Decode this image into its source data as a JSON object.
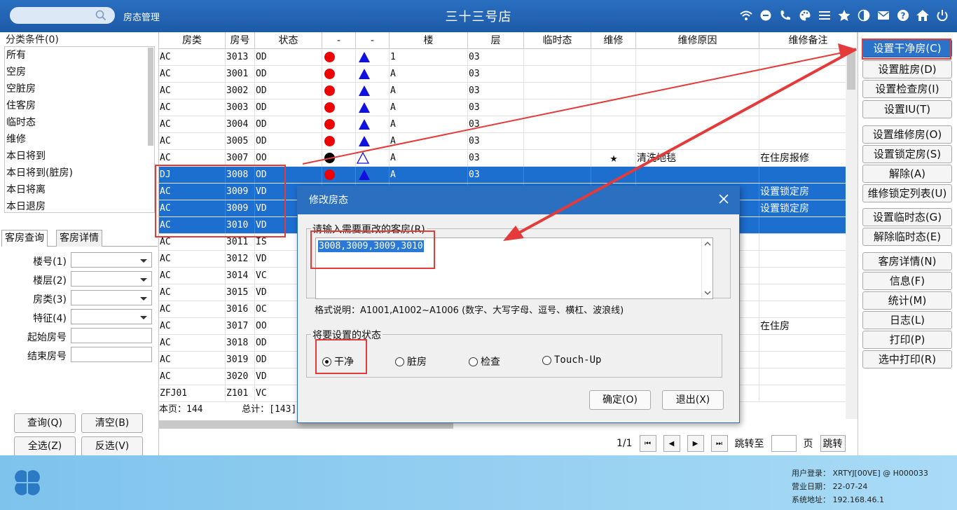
{
  "app": {
    "module": "房态管理",
    "title": "三十三号店"
  },
  "left": {
    "category_header": "分类条件(0)",
    "categories": [
      "所有",
      "空房",
      "空脏房",
      "住客房",
      "临时态",
      "维修",
      "本日将到",
      "本日将到(脏房)",
      "本日将离",
      "本日退房"
    ],
    "tabs": [
      "客房查询",
      "客房详情"
    ],
    "filters": [
      {
        "label": "楼号(1)",
        "type": "select"
      },
      {
        "label": "楼层(2)",
        "type": "select"
      },
      {
        "label": "房类(3)",
        "type": "select"
      },
      {
        "label": "特征(4)",
        "type": "select"
      },
      {
        "label": "起始房号",
        "type": "input"
      },
      {
        "label": "结束房号",
        "type": "input"
      }
    ],
    "buttons": [
      "查询(Q)",
      "清空(B)",
      "全选(Z)",
      "反选(V)"
    ]
  },
  "grid": {
    "columns": [
      "房类",
      "房号",
      "状态",
      "-",
      "-",
      "楼",
      "层",
      "临时态",
      "维修",
      "维修原因",
      "维修备注"
    ],
    "rows": [
      {
        "type": "AC",
        "no": "3013",
        "st": "OD",
        "dot": "red",
        "tri": "filled",
        "bld": "1",
        "fl": "03",
        "tmp": "",
        "rep": "",
        "reason": "",
        "note": "",
        "sel": false
      },
      {
        "type": "AC",
        "no": "3001",
        "st": "OD",
        "dot": "red",
        "tri": "filled",
        "bld": "A",
        "fl": "03",
        "tmp": "",
        "rep": "",
        "reason": "",
        "note": "",
        "sel": false
      },
      {
        "type": "AC",
        "no": "3002",
        "st": "OD",
        "dot": "red",
        "tri": "filled",
        "bld": "A",
        "fl": "03",
        "tmp": "",
        "rep": "",
        "reason": "",
        "note": "",
        "sel": false
      },
      {
        "type": "AC",
        "no": "3003",
        "st": "OD",
        "dot": "red",
        "tri": "filled",
        "bld": "A",
        "fl": "03",
        "tmp": "",
        "rep": "",
        "reason": "",
        "note": "",
        "sel": false
      },
      {
        "type": "AC",
        "no": "3004",
        "st": "OD",
        "dot": "red",
        "tri": "filled",
        "bld": "A",
        "fl": "03",
        "tmp": "",
        "rep": "",
        "reason": "",
        "note": "",
        "sel": false
      },
      {
        "type": "AC",
        "no": "3005",
        "st": "OD",
        "dot": "red",
        "tri": "filled",
        "bld": "A",
        "fl": "03",
        "tmp": "",
        "rep": "",
        "reason": "",
        "note": "",
        "sel": false
      },
      {
        "type": "AC",
        "no": "3007",
        "st": "OO",
        "dot": "black",
        "tri": "outline",
        "bld": "A",
        "fl": "03",
        "tmp": "",
        "rep": "★",
        "reason": "清洗地毯",
        "note": "在住房报修",
        "sel": false
      },
      {
        "type": "DJ",
        "no": "3008",
        "st": "OD",
        "dot": "red",
        "tri": "filled",
        "bld": "A",
        "fl": "03",
        "tmp": "",
        "rep": "",
        "reason": "",
        "note": "",
        "sel": true
      },
      {
        "type": "AC",
        "no": "3009",
        "st": "VD",
        "dot": "",
        "tri": "",
        "bld": "",
        "fl": "",
        "tmp": "",
        "rep": "",
        "reason": "",
        "note": "设置锁定房",
        "sel": true
      },
      {
        "type": "AC",
        "no": "3009",
        "st": "VD",
        "dot": "",
        "tri": "",
        "bld": "",
        "fl": "",
        "tmp": "",
        "rep": "",
        "reason": "",
        "note": "设置锁定房",
        "sel": true
      },
      {
        "type": "AC",
        "no": "3010",
        "st": "VD",
        "dot": "",
        "tri": "",
        "bld": "",
        "fl": "",
        "tmp": "",
        "rep": "",
        "reason": "",
        "note": "",
        "sel": true
      },
      {
        "type": "AC",
        "no": "3011",
        "st": "IS",
        "dot": "",
        "tri": "",
        "bld": "",
        "fl": "",
        "tmp": "",
        "rep": "",
        "reason": "",
        "note": "",
        "sel": false
      },
      {
        "type": "AC",
        "no": "3012",
        "st": "VD",
        "dot": "",
        "tri": "",
        "bld": "",
        "fl": "",
        "tmp": "",
        "rep": "",
        "reason": "",
        "note": "",
        "sel": false
      },
      {
        "type": "AC",
        "no": "3014",
        "st": "VC",
        "dot": "",
        "tri": "",
        "bld": "",
        "fl": "",
        "tmp": "",
        "rep": "",
        "reason": "",
        "note": "",
        "sel": false
      },
      {
        "type": "AC",
        "no": "3015",
        "st": "VD",
        "dot": "",
        "tri": "",
        "bld": "",
        "fl": "",
        "tmp": "",
        "rep": "",
        "reason": "",
        "note": "",
        "sel": false
      },
      {
        "type": "AC",
        "no": "3016",
        "st": "OC",
        "dot": "",
        "tri": "",
        "bld": "",
        "fl": "",
        "tmp": "",
        "rep": "",
        "reason": "",
        "note": "",
        "sel": false
      },
      {
        "type": "AC",
        "no": "3017",
        "st": "OO",
        "dot": "",
        "tri": "",
        "bld": "",
        "fl": "",
        "tmp": "",
        "rep": "",
        "reason": "",
        "note": "在住房",
        "sel": false
      },
      {
        "type": "AC",
        "no": "3018",
        "st": "OD",
        "dot": "",
        "tri": "",
        "bld": "",
        "fl": "",
        "tmp": "",
        "rep": "",
        "reason": "",
        "note": "",
        "sel": false
      },
      {
        "type": "AC",
        "no": "3019",
        "st": "OD",
        "dot": "",
        "tri": "",
        "bld": "",
        "fl": "",
        "tmp": "",
        "rep": "",
        "reason": "",
        "note": "",
        "sel": false
      },
      {
        "type": "AC",
        "no": "3020",
        "st": "VD",
        "dot": "",
        "tri": "",
        "bld": "",
        "fl": "",
        "tmp": "",
        "rep": "",
        "reason": "",
        "note": "",
        "sel": false
      },
      {
        "type": "ZFJ01",
        "no": "Z101",
        "st": "VC",
        "dot": "",
        "tri": "",
        "bld": "",
        "fl": "",
        "tmp": "",
        "rep": "",
        "reason": "",
        "note": "",
        "sel": false
      }
    ],
    "summary_page": "本页：144",
    "summary_total": "总计：[143]"
  },
  "pager": {
    "page": "1/1",
    "jump_label": "跳转至",
    "page_unit": "页",
    "jump_button": "跳转"
  },
  "right_buttons": [
    "设置干净房(C)",
    "设置脏房(D)",
    "设置检查房(I)",
    "设置IU(T)",
    "设置维修房(O)",
    "设置锁定房(S)",
    "解除(A)",
    "维修锁定列表(U)",
    "设置临时态(G)",
    "解除临时态(E)",
    "客房详情(N)",
    "信息(F)",
    "统计(M)",
    "日志(L)",
    "打印(P)",
    "选中打印(R)"
  ],
  "footer": {
    "user": "用户登录：  XRTYJ[00VE] @ H000033",
    "date": "营业日期：  22-07-24",
    "addr": "系统地址：  192.168.46.1"
  },
  "dialog": {
    "title": "修改房态",
    "input_label": "请输入需要更改的客房(R)",
    "input_value": "3008,3009,3009,3010",
    "hint": "格式说明：A1001,A1002~A1006 (数字、大写字母、逗号、横杠、波浪线)",
    "status_label": "将要设置的状态",
    "options": [
      "干净",
      "脏房",
      "检查",
      "Touch-Up"
    ],
    "selected_option": 0,
    "ok": "确定(O)",
    "cancel": "退出(X)"
  }
}
